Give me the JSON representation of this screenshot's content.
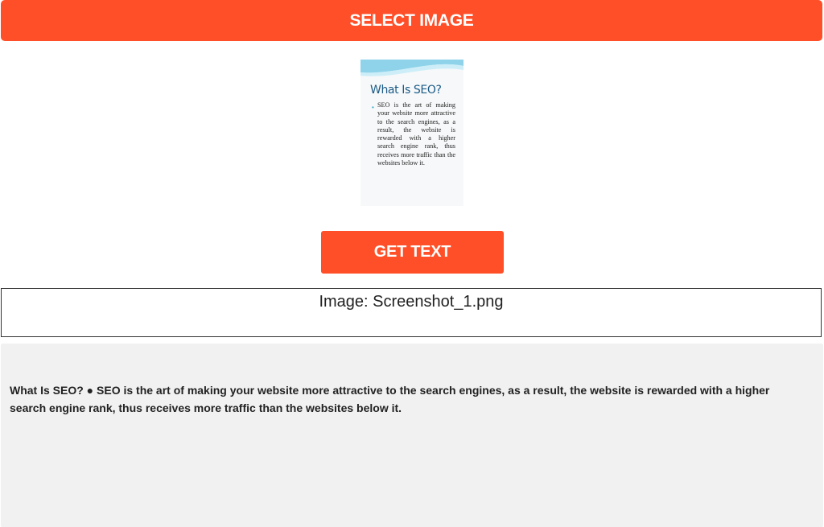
{
  "select_button": {
    "label": "SELECT IMAGE"
  },
  "preview": {
    "title": "What Is SEO?",
    "bullet": "•",
    "body": "SEO is the art of making your website more attractive to the search engines, as a result, the website is rewarded with a higher search engine rank, thus receives more traffic than the websites below it."
  },
  "get_text_button": {
    "label": "GET TEXT"
  },
  "file_info": {
    "text": "Image: Screenshot_1.png"
  },
  "result": {
    "text": "What Is SEO? ● SEO is the art of making your website more attractive to the search engines, as a result, the website is rewarded with a higher search engine rank, thus receives more traffic than the websites below it."
  },
  "colors": {
    "accent": "#ff4f28",
    "result_bg": "#f1f1f1",
    "preview_title": "#1a5a86"
  }
}
